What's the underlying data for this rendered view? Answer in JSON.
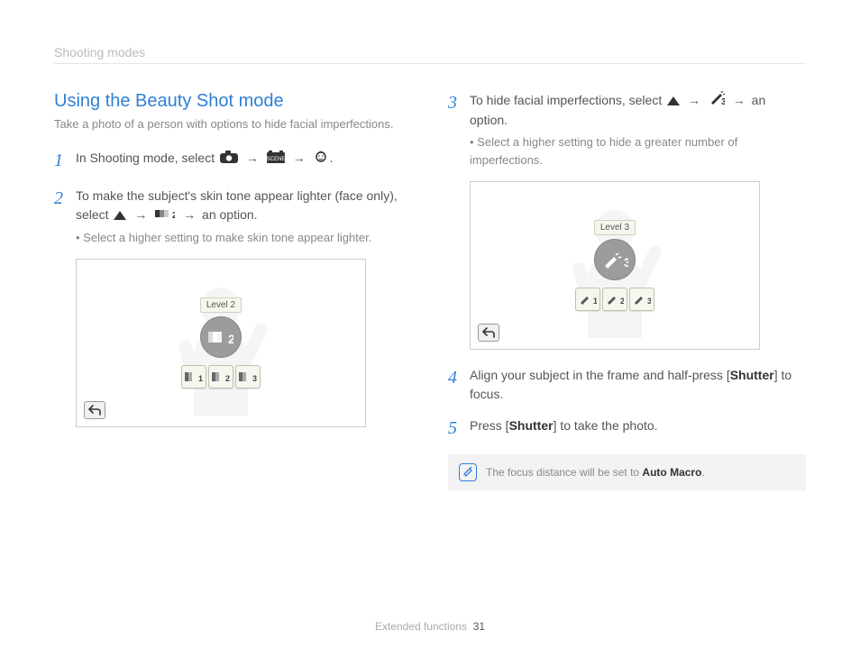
{
  "breadcrumb": "Shooting modes",
  "title": "Using the Beauty Shot mode",
  "intro": "Take a photo of a person with options to hide facial imperfections.",
  "steps": {
    "s1": "In Shooting mode, select",
    "s1_end": ".",
    "s2": "To make the subject's skin tone appear lighter (face only), select",
    "s2_end": "an option.",
    "s2_sub": "Select a higher setting to make skin tone appear lighter.",
    "s3": "To hide facial imperfections, select",
    "s3_end": "an option.",
    "s3_sub": "Select a higher setting to hide a greater number of imperfections.",
    "s4_a": "Align your subject in the frame and half-press [",
    "s4_b": "Shutter",
    "s4_c": "] to focus.",
    "s5_a": "Press [",
    "s5_b": "Shutter",
    "s5_c": "] to take the photo."
  },
  "shot1": {
    "tooltip": "Level 2",
    "big": "2",
    "opts": [
      "1",
      "2",
      "3"
    ]
  },
  "shot2": {
    "tooltip": "Level 3",
    "big": "3",
    "opts": [
      "1",
      "2",
      "3"
    ]
  },
  "note_a": "The focus distance will be set to ",
  "note_b": "Auto Macro",
  "note_c": ".",
  "footer_section": "Extended functions",
  "page_number": "31",
  "icons": {
    "arrow": "→"
  }
}
